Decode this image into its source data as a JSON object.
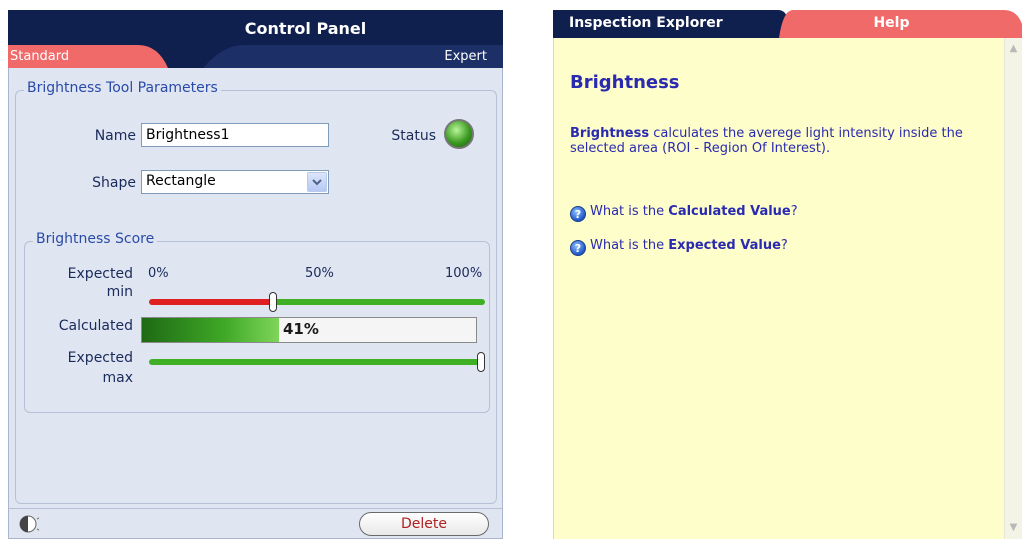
{
  "control_panel": {
    "title": "Control Panel",
    "tabs": {
      "standard": "Standard",
      "expert": "Expert"
    },
    "params_group": {
      "legend": "Brightness Tool Parameters",
      "name_label": "Name",
      "name_value": "Brightness1",
      "status_label": "Status",
      "status_color": "#3c9a22",
      "shape_label": "Shape",
      "shape_value": "Rectangle"
    },
    "score_group": {
      "legend": "Brightness Score",
      "scale": {
        "min": "0%",
        "mid": "50%",
        "max": "100%"
      },
      "expected_min_label_1": "Expected",
      "expected_min_label_2": "min",
      "expected_min_value": 0.37,
      "calculated_label": "Calculated",
      "calculated_value": 0.41,
      "calculated_text": "41%",
      "expected_max_label_1": "Expected",
      "expected_max_label_2": "max",
      "expected_max_value": 1.0
    },
    "footer": {
      "delete_label": "Delete"
    },
    "colors": {
      "header": "#0f1f4e",
      "standard_tab": "#f06a6a",
      "track_red": "#e02020",
      "track_green": "#3fb024"
    }
  },
  "help_panel": {
    "tabs": {
      "inspection_explorer": "Inspection Explorer",
      "help": "Help"
    },
    "heading": "Brightness",
    "description_bold": "Brightness",
    "description_rest": " calculates the averege light intensity inside the selected area (ROI - Region Of Interest).",
    "links": [
      {
        "prefix": "What is the ",
        "bold": "Calculated Value",
        "suffix": "?"
      },
      {
        "prefix": "What is the ",
        "bold": "Expected Value",
        "suffix": "?"
      }
    ],
    "colors": {
      "background": "#fefecb",
      "text": "#2a2ab0",
      "tab_active": "#0f1f4e",
      "tab_help": "#f06a6a"
    }
  }
}
